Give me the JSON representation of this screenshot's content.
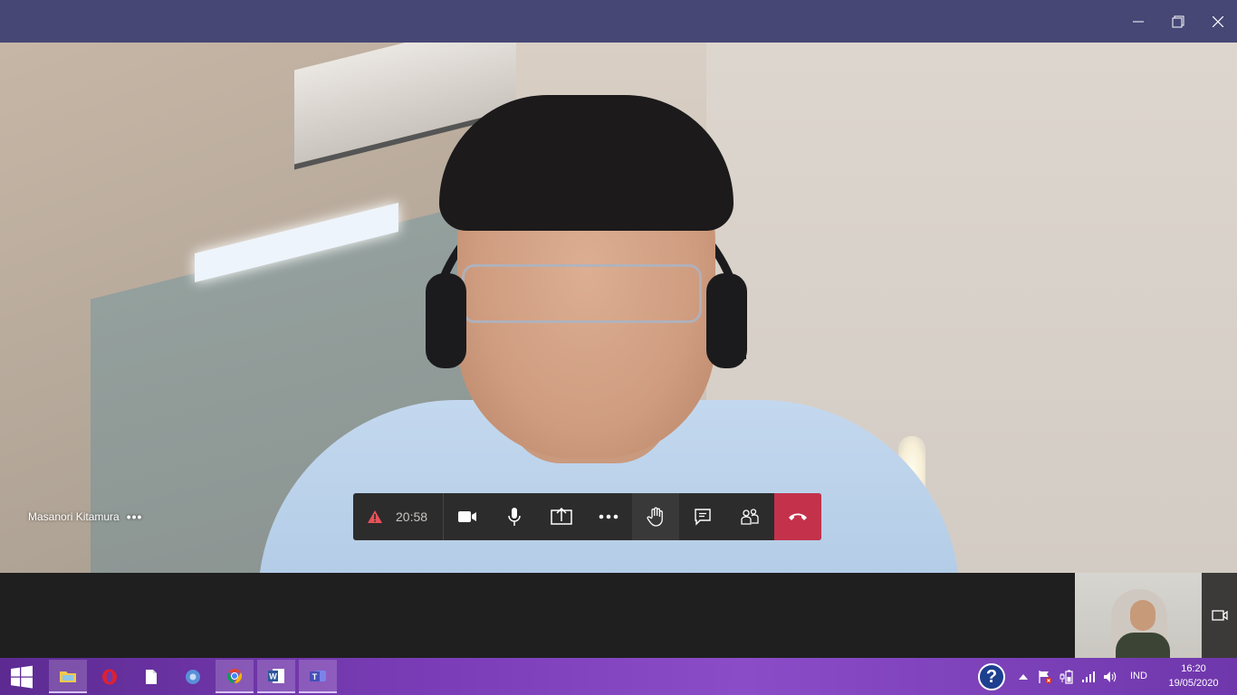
{
  "window": {
    "controls": [
      "minimize",
      "restore",
      "close"
    ]
  },
  "participant": {
    "name": "Masanori Kitamura",
    "more_label": "•••"
  },
  "call_controls": {
    "timer": "20:58",
    "warning_icon": "warning-icon",
    "buttons": [
      "camera",
      "microphone",
      "share-screen",
      "more-actions",
      "raise-hand",
      "conversation",
      "participants",
      "hang-up"
    ],
    "hangup_color": "#c4314b"
  },
  "taskbar": {
    "apps": [
      "file-explorer",
      "opera",
      "notepad",
      "chromium",
      "chrome",
      "word",
      "teams"
    ],
    "active_app": "teams",
    "language": "IND",
    "time": "16:20",
    "date": "19/05/2020"
  },
  "colors": {
    "title_bar": "#464775",
    "controls_bg": "#2d2c2c",
    "taskbar_accent": "#7b3db7"
  }
}
